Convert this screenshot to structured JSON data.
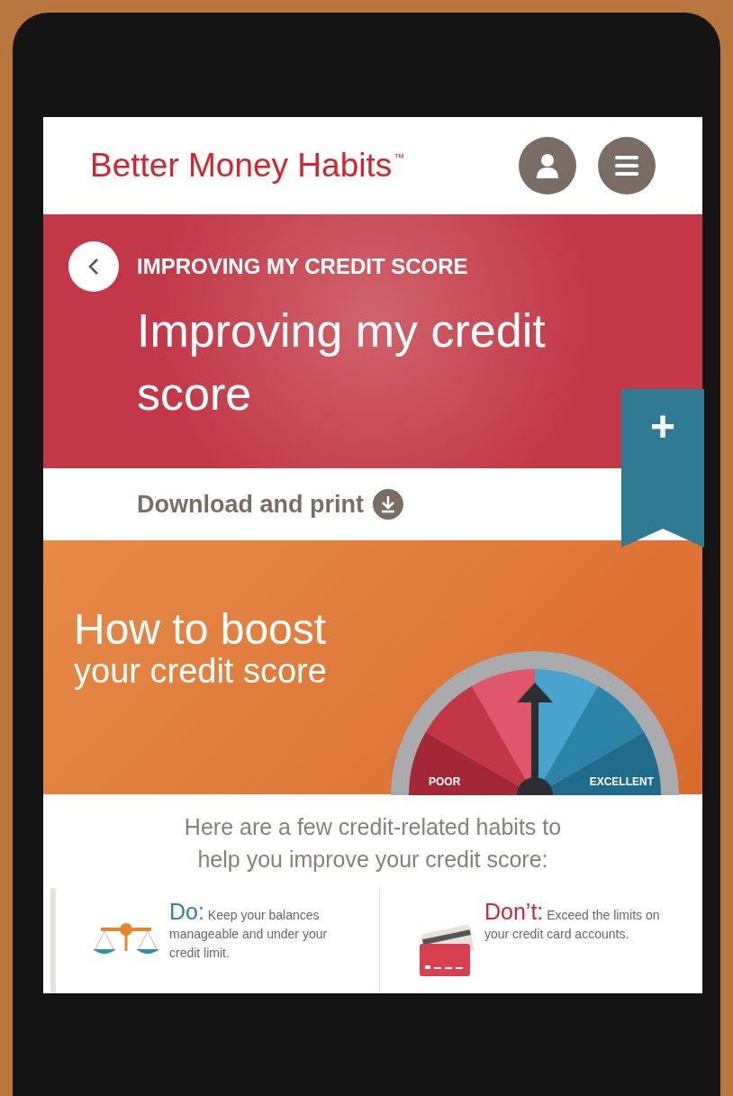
{
  "header": {
    "logo": "Better Money Habits",
    "trademark": "™"
  },
  "banner": {
    "eyebrow": "IMPROVING MY CREDIT SCORE",
    "title": "Improving my credit score"
  },
  "bookmark": {
    "label": "+"
  },
  "download": {
    "label": "Download and print"
  },
  "hero": {
    "title_line1": "How to boost",
    "title_line2": "your credit score",
    "gauge": {
      "low_label": "POOR",
      "high_label": "EXCELLENT"
    }
  },
  "intro": "Here are a few credit-related habits to help you improve your credit score:",
  "tips": [
    {
      "kind": "do",
      "heading": "Do:",
      "text": "Keep your balances manageable and under your credit limit."
    },
    {
      "kind": "dont",
      "heading": "Don’t:",
      "text": "Exceed the limits on your credit card accounts."
    }
  ]
}
